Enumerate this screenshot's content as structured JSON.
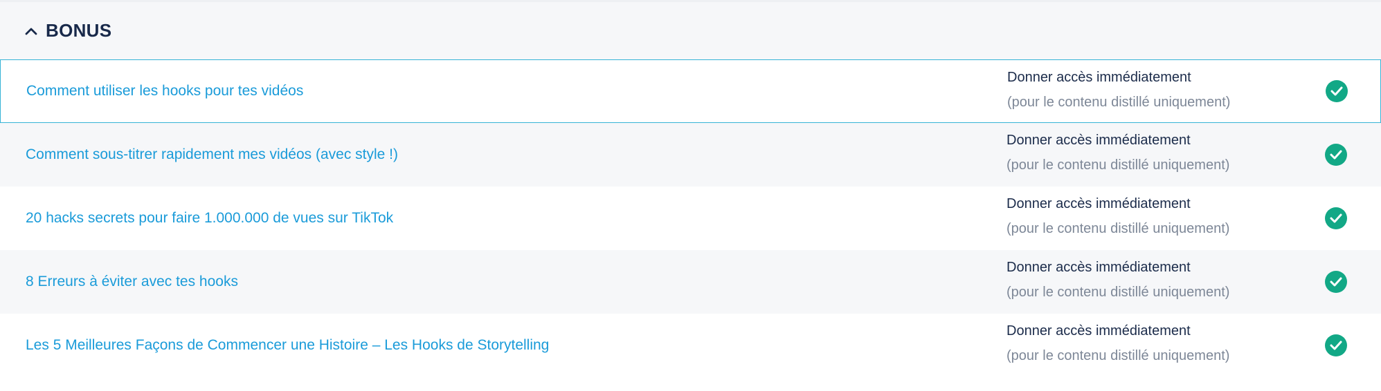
{
  "section": {
    "title": "BONUS",
    "expanded": true,
    "chevron_icon": "chevron-up-icon"
  },
  "colors": {
    "link": "#1a9bd9",
    "heading": "#18294a",
    "check": "#12a886",
    "selected_border": "#35b3d6",
    "muted": "#7d8797"
  },
  "lessons": [
    {
      "title": "Comment utiliser les hooks pour tes vidéos",
      "access_label": "Donner accès immédiatement",
      "access_note": "(pour le contenu distillé uniquement)",
      "status_icon": "check-circle-icon"
    },
    {
      "title": "Comment sous-titrer rapidement mes vidéos (avec style !)",
      "access_label": "Donner accès immédiatement",
      "access_note": "(pour le contenu distillé uniquement)",
      "status_icon": "check-circle-icon"
    },
    {
      "title": "20 hacks secrets pour faire 1.000.000 de vues sur TikTok",
      "access_label": "Donner accès immédiatement",
      "access_note": "(pour le contenu distillé uniquement)",
      "status_icon": "check-circle-icon"
    },
    {
      "title": "8 Erreurs à éviter avec tes hooks",
      "access_label": "Donner accès immédiatement",
      "access_note": "(pour le contenu distillé uniquement)",
      "status_icon": "check-circle-icon"
    },
    {
      "title": "Les 5 Meilleures Façons de Commencer une Histoire – Les Hooks de Storytelling",
      "access_label": "Donner accès immédiatement",
      "access_note": "(pour le contenu distillé uniquement)",
      "status_icon": "check-circle-icon"
    }
  ]
}
